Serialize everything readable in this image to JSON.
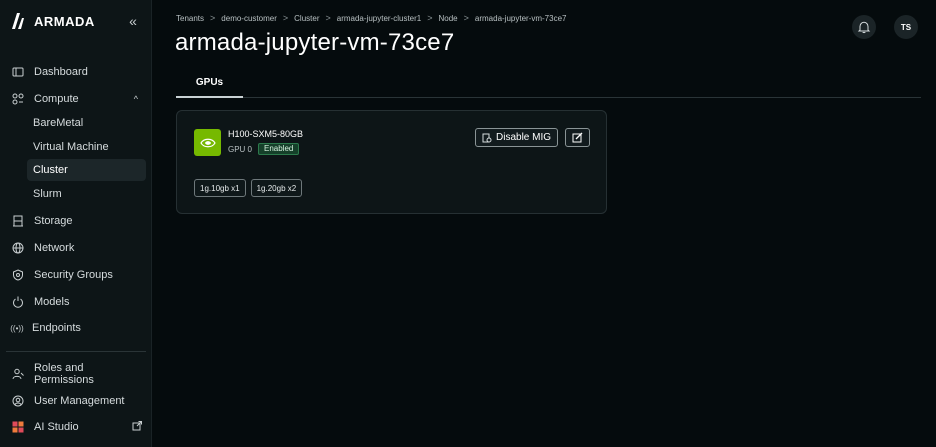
{
  "brand": {
    "name": "ARMADA"
  },
  "sidebar": {
    "collapse_label": "«",
    "items": [
      {
        "label": "Dashboard",
        "icon": "dashboard-icon"
      },
      {
        "label": "Compute",
        "icon": "compute-icon",
        "expanded": true,
        "children": [
          {
            "label": "BareMetal"
          },
          {
            "label": "Virtual Machine"
          },
          {
            "label": "Cluster",
            "active": true
          },
          {
            "label": "Slurm"
          }
        ]
      },
      {
        "label": "Storage",
        "icon": "storage-icon"
      },
      {
        "label": "Network",
        "icon": "network-icon"
      },
      {
        "label": "Security Groups",
        "icon": "security-icon"
      },
      {
        "label": "Models",
        "icon": "models-icon"
      },
      {
        "label": "Endpoints",
        "icon": "endpoints-icon"
      }
    ],
    "bottom_items": [
      {
        "label": "Roles and Permissions",
        "icon": "roles-icon"
      },
      {
        "label": "User Management",
        "icon": "user-management-icon"
      },
      {
        "label": "AI Studio",
        "icon": "ai-studio-icon"
      }
    ]
  },
  "breadcrumb": [
    "Tenants",
    "demo-customer",
    "Cluster",
    "armada-jupyter-cluster1",
    "Node",
    "armada-jupyter-vm-73ce7"
  ],
  "page": {
    "title": "armada-jupyter-vm-73ce7"
  },
  "header": {
    "avatar_initials": "TS"
  },
  "tabs": [
    {
      "label": "GPUs",
      "active": true
    }
  ],
  "gpu": {
    "model": "H100-SXM5-80GB",
    "index_label": "GPU 0",
    "status": "Enabled",
    "disable_mig_label": "Disable MIG",
    "mig_profiles": [
      "1g.10gb x1",
      "1g.20gb x2"
    ]
  },
  "colors": {
    "background": "#050b0d",
    "sidebar": "#0d1517",
    "nvidia_green": "#76b900",
    "enabled_badge": "#15402a"
  }
}
